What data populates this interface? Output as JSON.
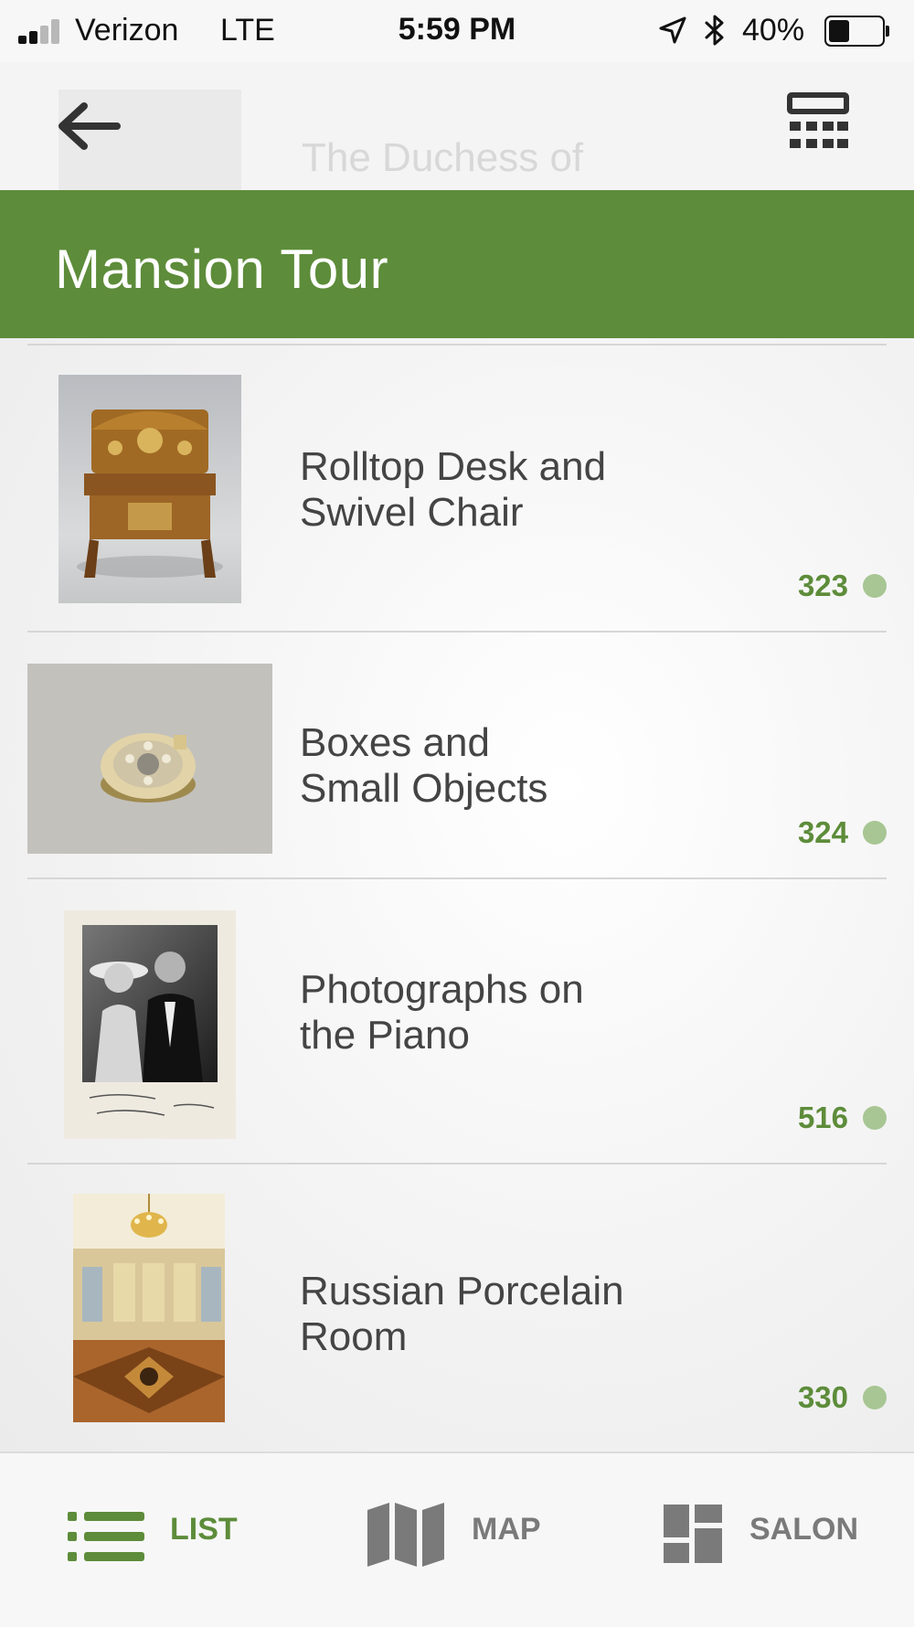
{
  "status_bar": {
    "carrier": "Verizon",
    "network": "LTE",
    "time": "5:59 PM",
    "battery": "40%",
    "battery_level": 0.4
  },
  "top_nav": {
    "back_icon": "arrow-left-icon",
    "keypad_icon": "keypad-icon",
    "ghost_title": "The Duchess of"
  },
  "header": {
    "title": "Mansion Tour",
    "color": "#5d8c3a"
  },
  "stops": [
    {
      "title_line1": "Rolltop Desk and",
      "title_line2": "Swivel Chair",
      "number": "323"
    },
    {
      "title_line1": "Boxes and",
      "title_line2": "Small Objects",
      "number": "324"
    },
    {
      "title_line1": "Photographs on",
      "title_line2": "the Piano",
      "number": "516"
    },
    {
      "title_line1": "Russian Porcelain",
      "title_line2": "Room",
      "number": "330"
    }
  ],
  "tab_bar": {
    "tabs": [
      {
        "label": "LIST",
        "icon": "list-icon",
        "active": true
      },
      {
        "label": "MAP",
        "icon": "map-icon",
        "active": false
      },
      {
        "label": "SALON",
        "icon": "salon-icon",
        "active": false
      }
    ],
    "active_color": "#5d8c3a",
    "inactive_color": "#7a7a7a"
  }
}
